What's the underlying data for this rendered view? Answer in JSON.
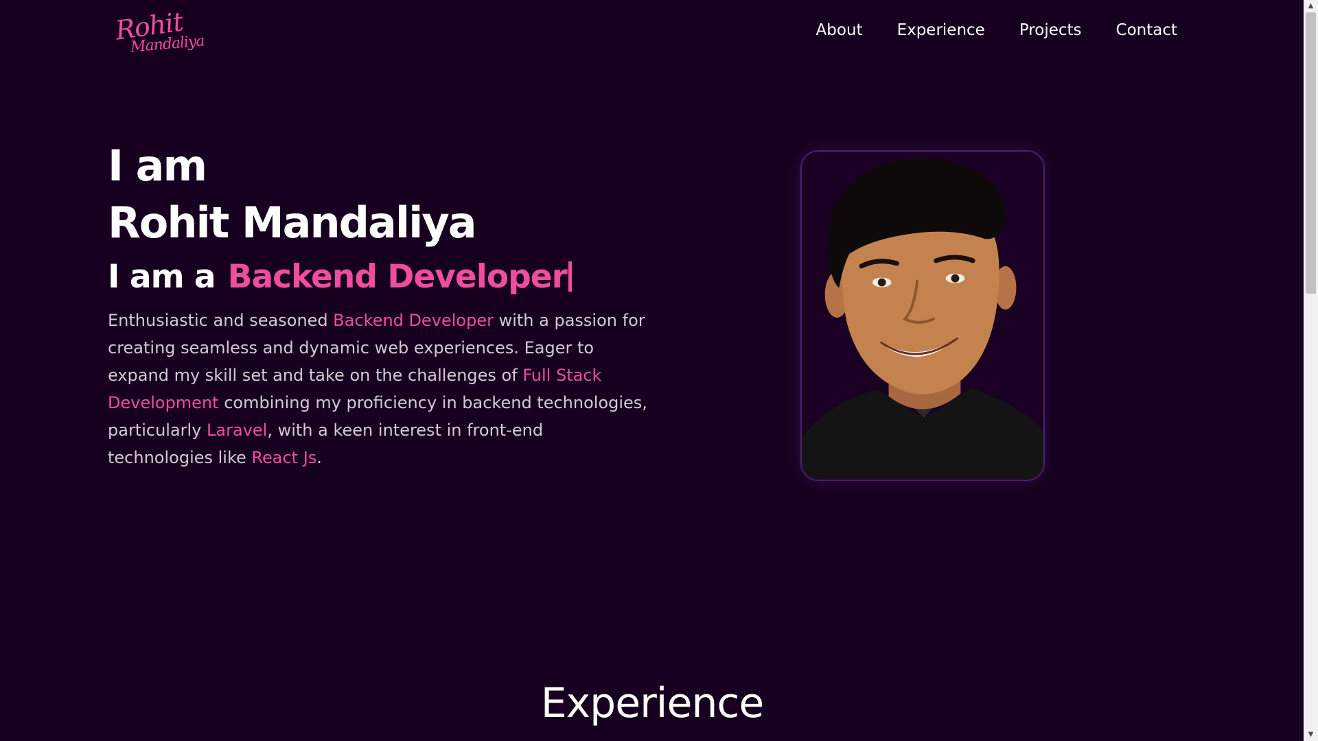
{
  "logo": {
    "line1": "Rohit",
    "line2": "Mandaliya"
  },
  "nav": {
    "about": "About",
    "experience": "Experience",
    "projects": "Projects",
    "contact": "Contact"
  },
  "hero": {
    "line1": "I am",
    "line2": "Rohit Mandaliya",
    "role_prefix": "I am a",
    "role": "Backend Developer"
  },
  "bio": {
    "p1": "Enthusiastic and seasoned ",
    "h1": "Backend Developer",
    "p2": " with a passion for creating seamless and dynamic web experiences. Eager to expand my skill set and take on the challenges of ",
    "h2": "Full Stack Development",
    "p3": " combining my proficiency in backend technologies, particularly ",
    "h3": "Laravel",
    "p4": ", with a keen interest in front-end technologies like ",
    "h4": "React Js",
    "p5": "."
  },
  "section": {
    "title": "Experience"
  },
  "colors": {
    "background": "#17001f",
    "accent": "#ef4ea0",
    "text": "#ffffff",
    "muted_text": "#d3c9d6"
  },
  "icons": {
    "scroll_up": "chevron-up-icon",
    "scroll_down": "chevron-down-icon"
  }
}
